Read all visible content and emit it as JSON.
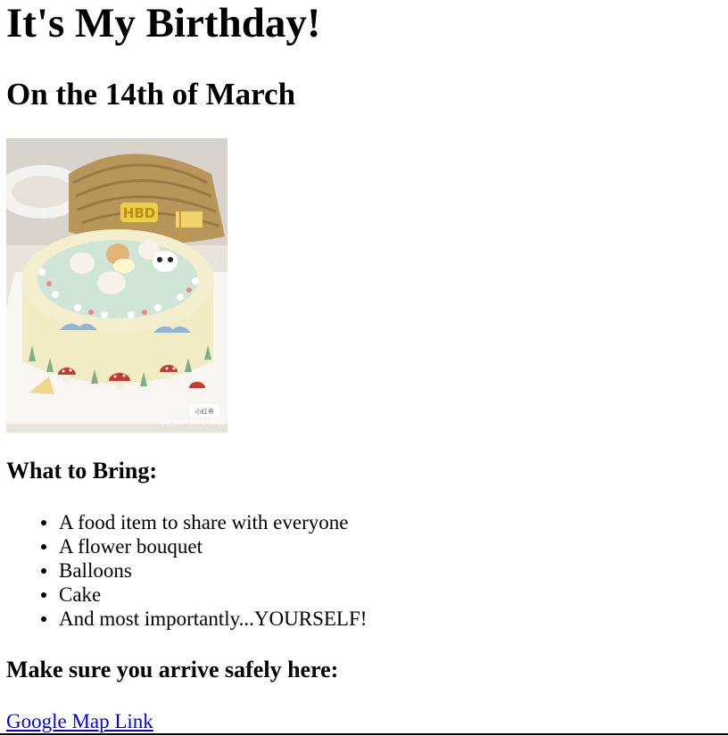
{
  "header": {
    "title": "It's My Birthday!",
    "subtitle": "On the 14th of March"
  },
  "image": {
    "icon": "birthday-cake-photo",
    "watermark": "小红书ID: 747176920",
    "badge": "小红书",
    "topper_text": "HBD"
  },
  "bring": {
    "heading": "What to Bring:",
    "items": [
      "A food item to share with everyone",
      "A flower bouquet",
      "Balloons",
      "Cake",
      "And most importantly...YOURSELF!"
    ]
  },
  "location": {
    "heading": "Make sure you arrive safely here:",
    "link_text": "Google Map Link"
  },
  "colors": {
    "link": "#0000ee",
    "text": "#000000",
    "background": "#ffffff"
  }
}
